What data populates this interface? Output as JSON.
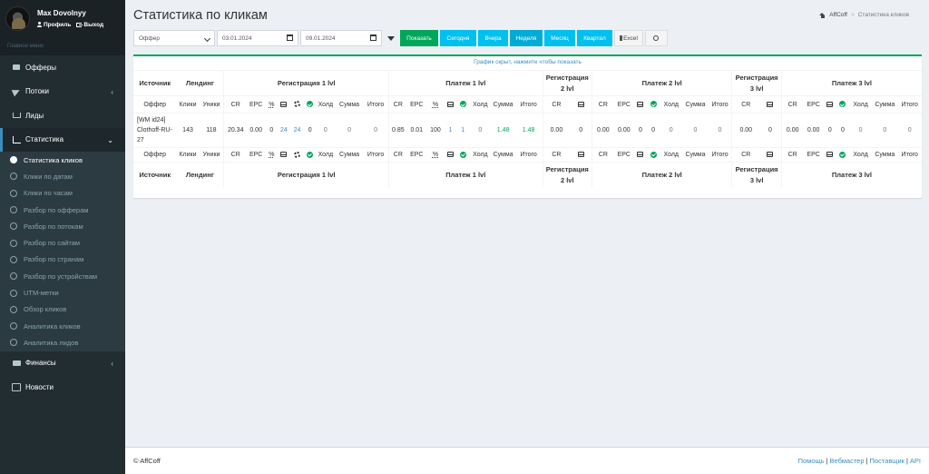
{
  "user": {
    "name": "Max Dovolnyy",
    "profile": "Профиль",
    "logout": "Выход"
  },
  "sidebar": {
    "header": "Главное меню",
    "items": [
      {
        "label": "Офферы",
        "icon": "gift-icon"
      },
      {
        "label": "Потоки",
        "icon": "paper-plane-icon",
        "chevron": "‹"
      },
      {
        "label": "Лиды",
        "icon": "cart-icon"
      },
      {
        "label": "Статистика",
        "icon": "area-chart-icon",
        "chevron": "⌄"
      },
      {
        "label": "Финансы",
        "icon": "money-icon",
        "chevron": "‹"
      },
      {
        "label": "Новости",
        "icon": "newspaper-icon"
      }
    ],
    "sub_items": [
      "Статистика кликов",
      "Клики по датам",
      "Клики по часам",
      "Разбор по офферам",
      "Разбор по потокам",
      "Разбор по сайтам",
      "Разбор по странам",
      "Разбор по устройствам",
      "UTM-метки",
      "Обзор кликов",
      "Аналитика кликов",
      "Аналитика лидов"
    ]
  },
  "page": {
    "title": "Статистика по кликам"
  },
  "breadcrumb": {
    "home": "AffCoff",
    "current": "Статистика кликов"
  },
  "toolbar": {
    "offer_select": "Оффер",
    "date_from": "03.01.2024",
    "date_to": "09.01.2024",
    "show": "Показать",
    "today": "Сегодня",
    "yesterday": "Вчера",
    "week": "Неделя",
    "month": "Месяц",
    "quarter": "Квартал",
    "excel": "Excel"
  },
  "chart_hint": "График скрыт, нажмите чтобы показать",
  "table": {
    "groups": {
      "source": "Источник",
      "landing": "Лендинг",
      "reg1": "Регистрация 1 lvl",
      "pay1": "Платеж 1 lvl",
      "reg2": "Регистрация 2 lvl",
      "pay2": "Платеж 2 lvl",
      "reg3": "Регистрация 3 lvl",
      "pay3": "Платеж 3 lvl"
    },
    "cols": {
      "offer": "Оффер",
      "clicks": "Клики",
      "uniq": "Уники",
      "cr": "CR",
      "epc": "EPC",
      "pct": "%",
      "hold": "Холд",
      "sum": "Сумма",
      "total": "Итого"
    },
    "row": {
      "offer": "[WM id24] Clothoff-RU-27",
      "clicks": "143",
      "uniq": "118",
      "r1_cr": "20.34",
      "r1_epc": "0.00",
      "r1_pct": "0",
      "r1_inbox": "24",
      "r1_gear": "24",
      "r1_check": "0",
      "r1_hold": "0",
      "r1_sum": "0",
      "r1_total": "0",
      "p1_cr": "0.85",
      "p1_epc": "0.01",
      "p1_pct": "100",
      "p1_inbox": "1",
      "p1_check": "1",
      "p1_hold": "0",
      "p1_sum": "1.48",
      "p1_total": "1.48",
      "r2_cr": "0.00",
      "r2_inbox": "0",
      "p2_cr": "0.00",
      "p2_epc": "0.00",
      "p2_inbox": "0",
      "p2_check": "0",
      "p2_hold": "0",
      "p2_sum": "0",
      "p2_total": "0",
      "r3_cr": "0.00",
      "r3_inbox": "0",
      "p3_cr": "0.00",
      "p3_epc": "0.00",
      "p3_inbox": "0",
      "p3_check": "0",
      "p3_hold": "0",
      "p3_sum": "0",
      "p3_total": "0"
    }
  },
  "footer": {
    "copyright": "© AffCoff",
    "links": [
      "Помощь",
      "Вебмастер",
      "Поставщик",
      "API"
    ]
  }
}
